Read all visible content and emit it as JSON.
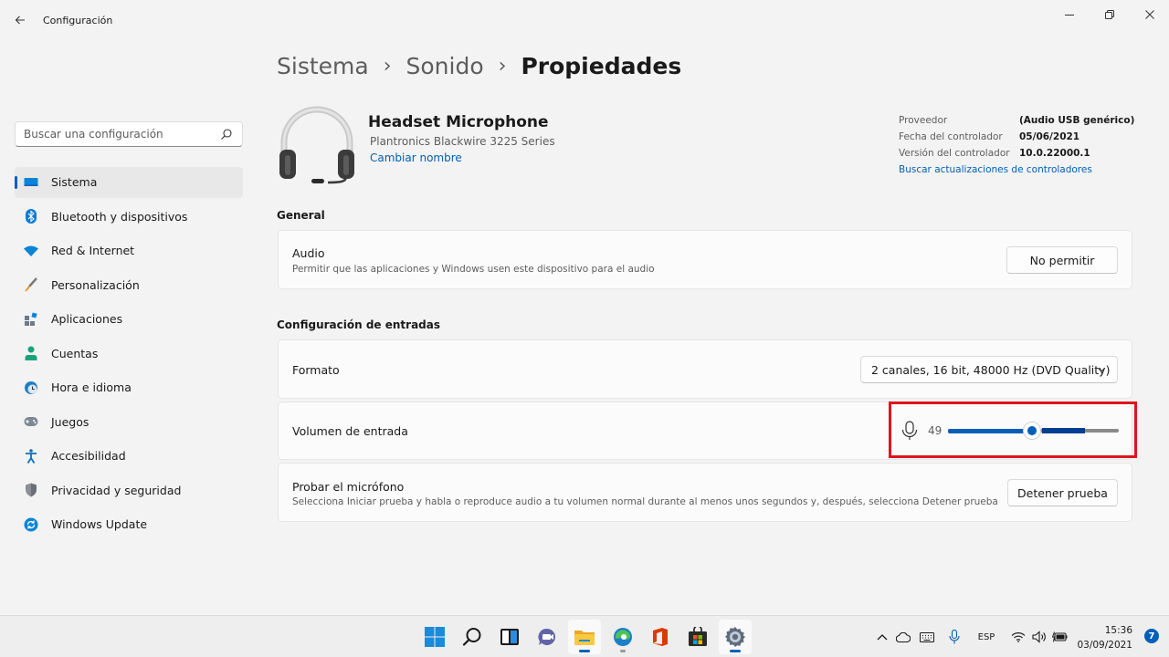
{
  "window": {
    "title": "Configuración"
  },
  "search": {
    "placeholder": "Buscar una configuración"
  },
  "sidebar": {
    "items": [
      {
        "label": "Sistema",
        "icon": "monitor-icon",
        "active": true
      },
      {
        "label": "Bluetooth y dispositivos",
        "icon": "bluetooth-icon"
      },
      {
        "label": "Red & Internet",
        "icon": "wifi-icon"
      },
      {
        "label": "Personalización",
        "icon": "brush-icon"
      },
      {
        "label": "Aplicaciones",
        "icon": "apps-icon"
      },
      {
        "label": "Cuentas",
        "icon": "person-icon"
      },
      {
        "label": "Hora e idioma",
        "icon": "clock-globe-icon"
      },
      {
        "label": "Juegos",
        "icon": "gamepad-icon"
      },
      {
        "label": "Accesibilidad",
        "icon": "accessibility-icon"
      },
      {
        "label": "Privacidad y seguridad",
        "icon": "shield-icon"
      },
      {
        "label": "Windows Update",
        "icon": "update-icon"
      }
    ]
  },
  "breadcrumb": {
    "level1": "Sistema",
    "level2": "Sonido",
    "current": "Propiedades",
    "separator": "›"
  },
  "device": {
    "name": "Headset Microphone",
    "model": "Plantronics Blackwire 3225 Series",
    "rename_link": "Cambiar nombre",
    "icon": "headset-icon"
  },
  "driver_info": {
    "rows": [
      {
        "key": "Proveedor",
        "value": "(Audio USB genérico)"
      },
      {
        "key": "Fecha del controlador",
        "value": "05/06/2021"
      },
      {
        "key": "Versión del controlador",
        "value": "10.0.22000.1"
      }
    ],
    "update_link": "Buscar actualizaciones de controladores"
  },
  "general": {
    "heading": "General",
    "audio": {
      "title": "Audio",
      "description": "Permitir que las aplicaciones y Windows usen este dispositivo para el audio",
      "button": "No permitir"
    }
  },
  "input_config": {
    "heading": "Configuración de entradas",
    "format": {
      "title": "Formato",
      "value": "2 canales, 16 bit, 48000 Hz (DVD Quality)"
    },
    "volume": {
      "title": "Volumen de entrada",
      "value": "49",
      "level_percent": 49,
      "peak_percent": 80
    },
    "test": {
      "title": "Probar el micrófono",
      "description": "Selecciona Iniciar prueba y habla o reproduce audio a tu volumen normal durante al menos unos segundos y, después, selecciona Detener prueba",
      "button": "Detener prueba"
    }
  },
  "taskbar": {
    "apps": [
      "start-icon",
      "search-icon",
      "task-view-icon",
      "chat-icon",
      "file-explorer-icon",
      "edge-icon",
      "office-icon",
      "store-icon",
      "settings-icon"
    ],
    "language": "ESP",
    "time": "15:36",
    "date": "03/09/2021",
    "notifications": "7"
  },
  "colors": {
    "accent": "#005fb8",
    "highlight_border": "#e0141e"
  }
}
